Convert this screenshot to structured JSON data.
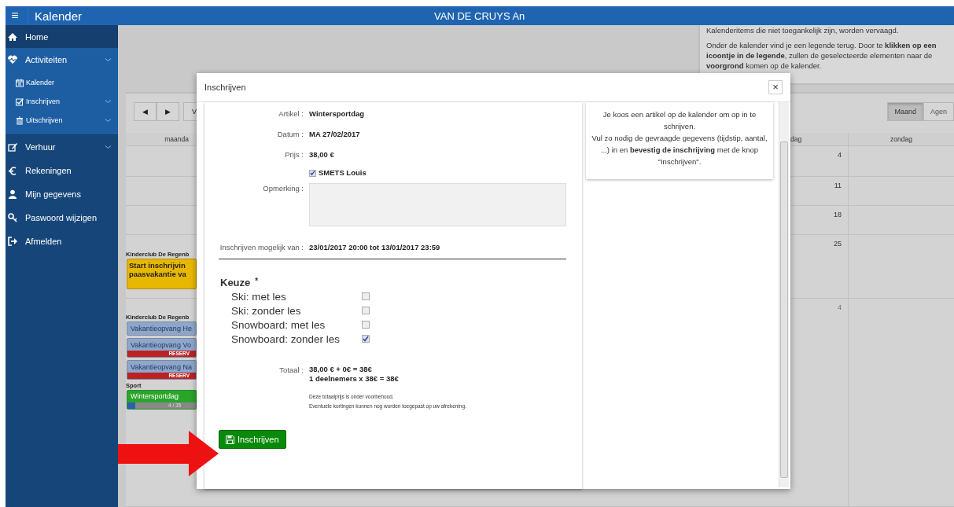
{
  "topbar": {
    "menu_glyph": "≡",
    "title": "Kalender",
    "user": "VAN DE CRUYS An"
  },
  "sidebar": {
    "items": [
      {
        "label": "Home",
        "expandable": false
      },
      {
        "label": "Activiteiten",
        "expandable": true,
        "expanded": true,
        "children": [
          {
            "label": "Kalender",
            "expandable": false
          },
          {
            "label": "Inschrijven",
            "expandable": true
          },
          {
            "label": "Uitschrijven",
            "expandable": true
          }
        ]
      },
      {
        "label": "Verhuur",
        "expandable": true,
        "expanded": false
      },
      {
        "label": "Rekeningen",
        "expandable": false
      },
      {
        "label": "Mijn gegevens",
        "expandable": false
      },
      {
        "label": "Paswoord wijzigen",
        "expandable": false
      },
      {
        "label": "Afmelden",
        "expandable": false
      }
    ]
  },
  "info_panel": {
    "paragraphs": [
      "Kalenderitems die niet toegankelijk zijn, worden vervaagd.",
      "Onder de kalender vind je een legende terug. Door te **klikken op een icoontje in de legende**, zullen de geselecteerde elementen naar de **voorgrond** komen op de kalender."
    ]
  },
  "calendar": {
    "nav_buttons": [
      "◀",
      "▶"
    ],
    "other_buttons": [
      "V"
    ],
    "views": [
      {
        "label": "Maand",
        "selected": true
      },
      {
        "label": "Agen",
        "selected": false
      }
    ],
    "columns": [
      "maanda",
      "dag",
      "zondag"
    ],
    "rows": [
      {
        "day": "4",
        "other_month": false
      },
      {
        "day": "11",
        "other_month": false
      },
      {
        "day": "18",
        "other_month": false
      },
      {
        "day": "25",
        "other_month": false,
        "groups": [
          {
            "title": "Kinderclub De Regenb",
            "events": [
              {
                "kind": "banner",
                "title": "Start inschrijvin\npaasvakantie va",
                "color": "#e8b800"
              }
            ]
          }
        ]
      },
      {
        "day": "4",
        "other_month": true,
        "groups": [
          {
            "title": "Kinderclub De Regenb",
            "events": [
              {
                "kind": "plain",
                "title": "Vakantieopvang He",
                "color": "#8ea6c9"
              },
              {
                "kind": "tagged",
                "title": "Vakantieopvang Vo",
                "tag": "RESERV",
                "color": "#8ea6c9"
              },
              {
                "kind": "tagged",
                "title": "Vakantieopvang Na",
                "tag": "RESERV",
                "color": "#8ea6c9"
              }
            ]
          },
          {
            "title": "Sport",
            "events": [
              {
                "kind": "progress",
                "title": "Wintersportdag",
                "count": "4 / 35",
                "level": 0.11,
                "color": "#2aa52a"
              }
            ]
          }
        ]
      }
    ]
  },
  "dialog": {
    "title": "Inschrijven",
    "close_glyph": "×",
    "fields": [
      {
        "label": "Artikel :",
        "value": "Wintersportdag"
      },
      {
        "label": "Datum :",
        "value": "MA 27/02/2017"
      },
      {
        "label": "Prijs :",
        "value": "38,00 €"
      }
    ],
    "participant": {
      "label": "SMETS Louis",
      "checked": true
    },
    "remark": {
      "label": "Opmerking :"
    },
    "period": {
      "label": "Inschrijven mogelijk van :",
      "value": "23/01/2017 20:00 tot 13/01/2017 23:59"
    },
    "choice": {
      "title": "Keuze",
      "required_mark": "*",
      "options": [
        {
          "label": "Ski: met les",
          "checked": false
        },
        {
          "label": "Ski: zonder les",
          "checked": false
        },
        {
          "label": "Snowboard: met les",
          "checked": false
        },
        {
          "label": "Snowboard: zonder les",
          "checked": true
        }
      ]
    },
    "total": {
      "label": "Totaal :",
      "lines": [
        "38,00 € + 0€ = 38€",
        "1 deelnemers x 38€ = 38€"
      ],
      "notes": [
        "Deze totaalprijs is onder voorbehoud.",
        "Eventuele kortingen kunnen nog worden toegepast op uw afrekening."
      ]
    },
    "submit": "Inschrijven",
    "help": [
      "Je koos een artikel op de kalender om op in te schrijven.",
      "Vul zo nodig de gevraagde gegevens (tijdstip, aantal, ...) in en **bevestig de inschrijving** met de knop \"Inschrijven\"."
    ]
  }
}
